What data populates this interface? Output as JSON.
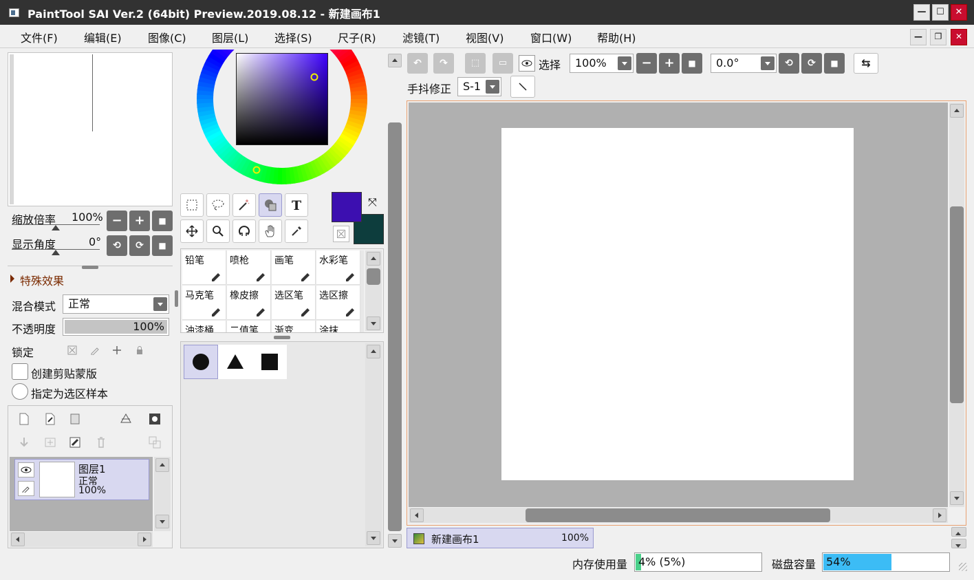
{
  "window": {
    "title": "PaintTool SAI Ver.2 (64bit) Preview.2019.08.12 - 新建画布1"
  },
  "menu": [
    {
      "label": "文件(F)"
    },
    {
      "label": "编辑(E)"
    },
    {
      "label": "图像(C)"
    },
    {
      "label": "图层(L)"
    },
    {
      "label": "选择(S)"
    },
    {
      "label": "尺子(R)"
    },
    {
      "label": "滤镜(T)"
    },
    {
      "label": "视图(V)"
    },
    {
      "label": "窗口(W)"
    },
    {
      "label": "帮助(H)"
    }
  ],
  "navigator": {
    "zoom_label": "缩放倍率",
    "zoom_value": "100%",
    "angle_label": "显示角度",
    "angle_value": "0°"
  },
  "effects": {
    "label": "特殊效果"
  },
  "layer_props": {
    "blend_label": "混合模式",
    "blend_value": "正常",
    "opacity_label": "不透明度",
    "opacity_value": "100%",
    "opacity_fraction": 1.0,
    "lock_label": "锁定",
    "clip_label": "创建剪贴蒙版",
    "sample_label": "指定为选区样本"
  },
  "layers": [
    {
      "name": "图层1",
      "mode": "正常",
      "opacity": "100%"
    }
  ],
  "colors": {
    "primary": "#3c0fb0",
    "secondary": "#0d3d3d",
    "selection": "#d8d8f0"
  },
  "brushes": [
    {
      "label": "铅笔"
    },
    {
      "label": "喷枪"
    },
    {
      "label": "画笔"
    },
    {
      "label": "水彩笔"
    },
    {
      "label": "马克笔"
    },
    {
      "label": "橡皮擦"
    },
    {
      "label": "选区笔"
    },
    {
      "label": "选区擦"
    },
    {
      "label": "油漆桶"
    },
    {
      "label": "二值笔"
    },
    {
      "label": "渐变"
    },
    {
      "label": "涂抹"
    }
  ],
  "toolbar": {
    "select_label": "选择",
    "zoom_value": "100%",
    "angle_value": "0.0°",
    "stabilizer_label": "手抖修正",
    "stabilizer_value": "S-1"
  },
  "canvas_tab": {
    "name": "新建画布1",
    "zoom": "100%"
  },
  "status": {
    "mem_label": "内存使用量",
    "mem_value": "4% (5%)",
    "mem_fraction": 0.04,
    "disk_label": "磁盘容量",
    "disk_value": "54%",
    "disk_fraction": 0.54
  }
}
